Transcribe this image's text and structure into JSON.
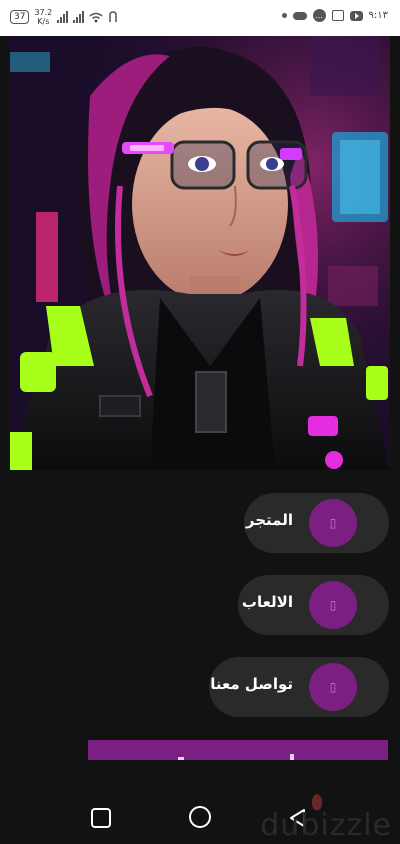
{
  "status_bar": {
    "badge": "37",
    "speed_value": "37.2",
    "speed_unit": "K/s",
    "time": "٩:١٣",
    "chat_icon_glyph": "…",
    "left_icons": [
      "signal-icon",
      "signal-icon",
      "wifi-icon",
      "nfc-icon"
    ],
    "right_icons": [
      "notification-dot-icon",
      "cloud-icon",
      "chat-icon",
      "image-icon",
      "youtube-icon"
    ]
  },
  "hero": {
    "icon": "cyberpunk-girl-image",
    "colors": {
      "neon_pink": "#ff2fd6",
      "neon_green": "#a8ff1a",
      "neon_blue": "#4fd7ff"
    }
  },
  "menu": {
    "items": [
      {
        "label": "المتجر",
        "icon_glyph": "▯",
        "icon": "store-icon"
      },
      {
        "label": "الالعاب",
        "icon_glyph": "▯",
        "icon": "games-icon"
      },
      {
        "label": "تواصل معنا",
        "icon_glyph": "▯",
        "icon": "contact-icon"
      }
    ],
    "accent_color": "#7b1f82"
  },
  "nav": {
    "watermark": "dubizzle",
    "icons": [
      "recents-icon",
      "home-icon",
      "back-icon"
    ]
  }
}
